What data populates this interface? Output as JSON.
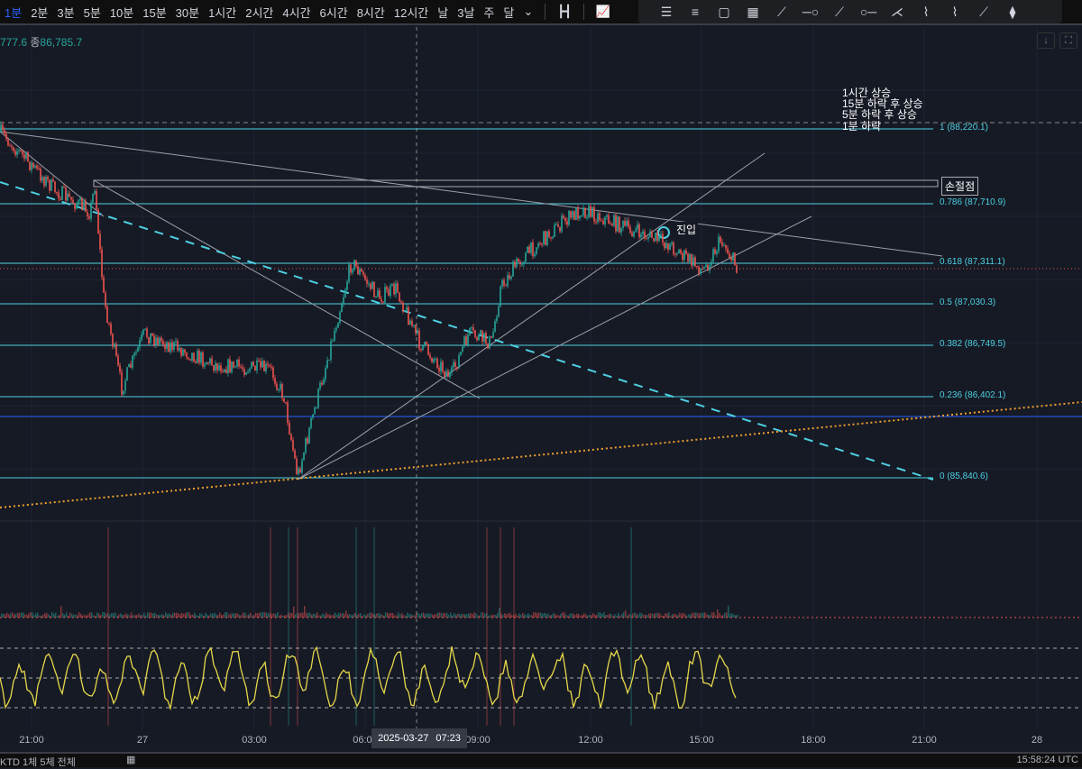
{
  "timeframes": [
    "1분",
    "2분",
    "3분",
    "5분",
    "10분",
    "15분",
    "30분",
    "1시간",
    "2시간",
    "4시간",
    "6시간",
    "8시간",
    "12시간",
    "날",
    "3날",
    "주",
    "달"
  ],
  "active_timeframe": "1분",
  "drawing_tools": [
    "horizontal-lines",
    "parallel-channel",
    "rectangle",
    "grid",
    "parallel-segments",
    "horizontal-ray",
    "trend-line",
    "ray",
    "pitchfork",
    "pattern",
    "pattern-2",
    "extended-line",
    "long-short-position"
  ],
  "legend": {
    "partial_value": "777.6",
    "close_label": "종",
    "close_value": "86,785.7"
  },
  "notes": [
    "1시간 상승",
    "15분 하락 후 상승",
    "5분 하락 후 상승",
    "1분 하락"
  ],
  "stop_label": "손절점",
  "entry_label": "진입",
  "fib_levels": [
    {
      "ratio": "1",
      "price": "88,220.1",
      "text": "1 (88,220.1)"
    },
    {
      "ratio": "0.786",
      "price": "87,710.9",
      "text": "0.786 (87,710.9)"
    },
    {
      "ratio": "0.618",
      "price": "87,311.1",
      "text": "0.618 (87,311.1)"
    },
    {
      "ratio": "0.5",
      "price": "87,030.3",
      "text": "0.5 (87,030.3)"
    },
    {
      "ratio": "0.382",
      "price": "86,749.5",
      "text": "0.382 (86,749.5)"
    },
    {
      "ratio": "0.236",
      "price": "86,402.1",
      "text": "0.236 (86,402.1)"
    },
    {
      "ratio": "0",
      "price": "85,840.6",
      "text": "0 (85,840.6)"
    }
  ],
  "time_ticks": [
    "21:00",
    "27",
    "03:00",
    "06:00",
    "09:00",
    "12:00",
    "15:00",
    "18:00",
    "21:00",
    "28"
  ],
  "crosshair": {
    "date": "2025-03-27",
    "time": "07:23"
  },
  "bottom": {
    "left": "KTD  1체  5체  전체",
    "right": "15:58:24 UTC"
  },
  "colors": {
    "up": "#26a69a",
    "down": "#ef5350",
    "fib": "#4dd0e1",
    "oscillator": "#e6d84a",
    "trend_dotted": "#f0a030"
  }
}
